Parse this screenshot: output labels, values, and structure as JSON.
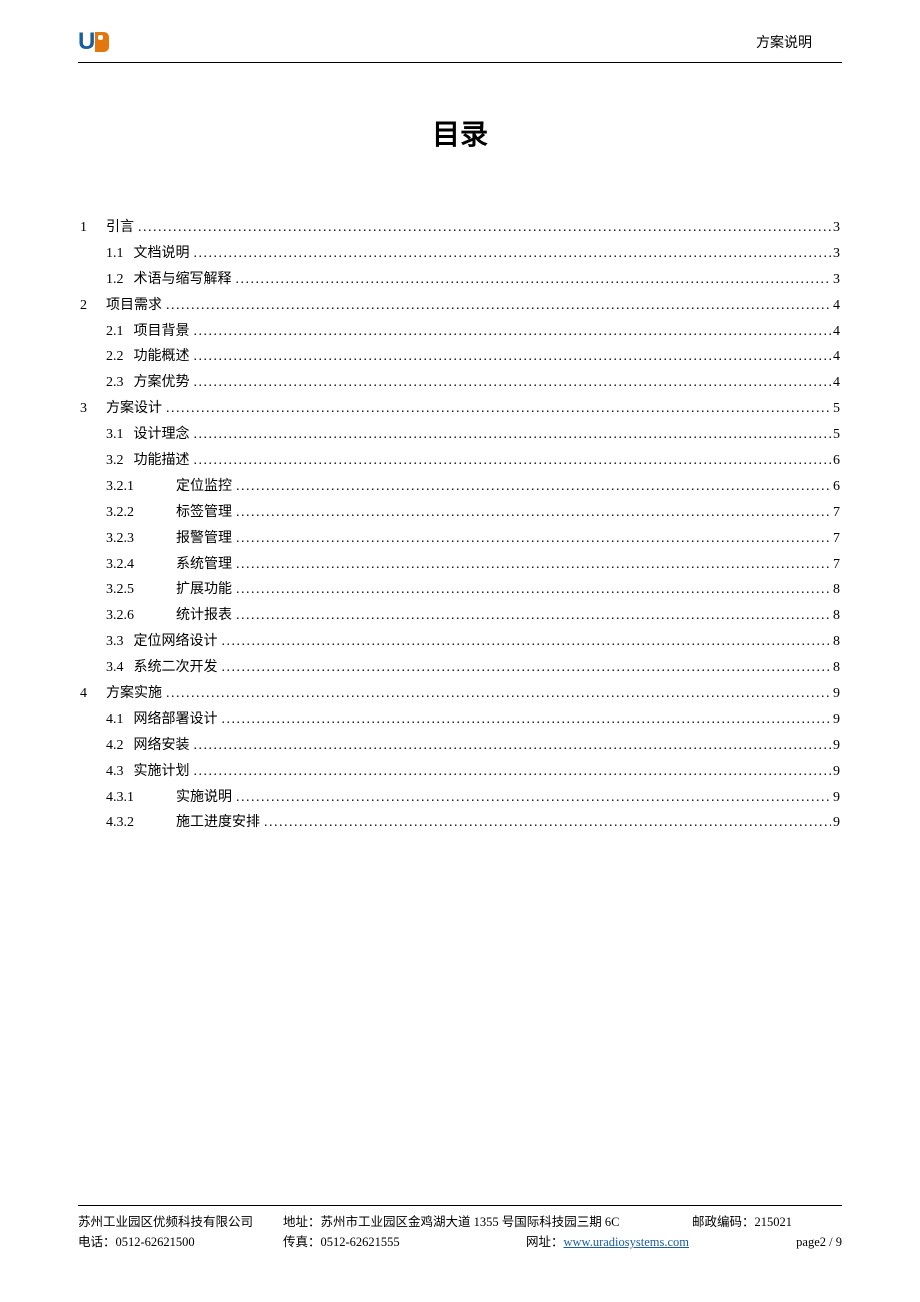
{
  "header": {
    "doc_label": "方案说明"
  },
  "title": "目录",
  "toc": [
    {
      "level": 0,
      "num": "1",
      "text": "引言",
      "page": "3"
    },
    {
      "level": 1,
      "num": "1.1",
      "text": "文档说明",
      "page": "3"
    },
    {
      "level": 1,
      "num": "1.2",
      "text": "术语与缩写解释",
      "page": "3"
    },
    {
      "level": 0,
      "num": "2",
      "text": "项目需求",
      "page": "4"
    },
    {
      "level": 1,
      "num": "2.1",
      "text": "项目背景",
      "page": "4"
    },
    {
      "level": 1,
      "num": "2.2",
      "text": "功能概述",
      "page": "4"
    },
    {
      "level": 1,
      "num": "2.3",
      "text": "方案优势",
      "page": "4"
    },
    {
      "level": 0,
      "num": "3",
      "text": "方案设计",
      "page": "5"
    },
    {
      "level": 1,
      "num": "3.1",
      "text": "设计理念",
      "page": "5"
    },
    {
      "level": 1,
      "num": "3.2",
      "text": "功能描述",
      "page": "6"
    },
    {
      "level": 2,
      "num": "3.2.1",
      "text": "定位监控",
      "page": "6"
    },
    {
      "level": 2,
      "num": "3.2.2",
      "text": "标签管理",
      "page": "7"
    },
    {
      "level": 2,
      "num": "3.2.3",
      "text": "报警管理",
      "page": "7"
    },
    {
      "level": 2,
      "num": "3.2.4",
      "text": "系统管理",
      "page": "7"
    },
    {
      "level": 2,
      "num": "3.2.5",
      "text": "扩展功能",
      "page": "8"
    },
    {
      "level": 2,
      "num": "3.2.6",
      "text": "统计报表",
      "page": "8"
    },
    {
      "level": 1,
      "num": "3.3",
      "text": "定位网络设计",
      "page": "8"
    },
    {
      "level": 1,
      "num": "3.4",
      "text": "系统二次开发",
      "page": "8"
    },
    {
      "level": 0,
      "num": "4",
      "text": "方案实施",
      "page": "9"
    },
    {
      "level": 1,
      "num": "4.1",
      "text": "网络部署设计",
      "page": "9"
    },
    {
      "level": 1,
      "num": "4.2",
      "text": "网络安装",
      "page": "9"
    },
    {
      "level": 1,
      "num": "4.3",
      "text": "实施计划",
      "page": "9"
    },
    {
      "level": 2,
      "num": "4.3.1",
      "text": "实施说明",
      "page": "9"
    },
    {
      "level": 2,
      "num": "4.3.2",
      "text": "施工进度安排",
      "page": "9"
    }
  ],
  "footer": {
    "company": "苏州工业园区优频科技有限公司",
    "address_label": "地址：",
    "address": "苏州市工业园区金鸡湖大道 1355 号国际科技园三期 6C",
    "postal_label": "邮政编码：",
    "postal": "215021",
    "phone_label": "电话：",
    "phone": "0512-62621500",
    "fax_label": "传真：",
    "fax": "0512-62621555",
    "web_label": "网址：",
    "web_url": "www.uradiosystems.com",
    "page_label": "page",
    "page_current": "2",
    "page_sep": " / ",
    "page_total": "9"
  }
}
